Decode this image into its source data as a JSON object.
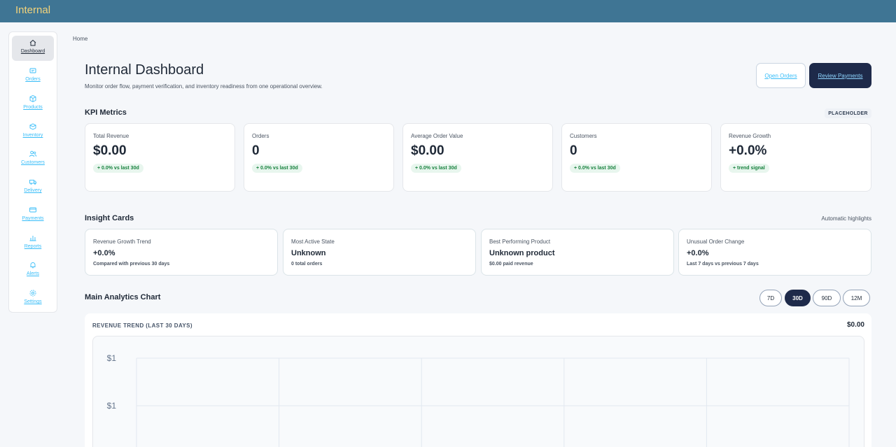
{
  "app": {
    "brand": "Internal"
  },
  "sidebar": {
    "items": [
      {
        "label": "Dashboard",
        "icon": "home-icon",
        "active": true
      },
      {
        "label": "Orders",
        "icon": "orders-icon"
      },
      {
        "label": "Products",
        "icon": "box-icon"
      },
      {
        "label": "Inventory",
        "icon": "inventory-icon"
      },
      {
        "label": "Customers",
        "icon": "users-icon"
      },
      {
        "label": "Delivery",
        "icon": "truck-icon"
      },
      {
        "label": "Payments",
        "icon": "card-icon"
      },
      {
        "label": "Reports",
        "icon": "bar-chart-icon"
      },
      {
        "label": "Alerts",
        "icon": "bell-icon"
      },
      {
        "label": "Settings",
        "icon": "gear-icon"
      }
    ]
  },
  "breadcrumb": "Home",
  "header": {
    "title": "Internal Dashboard",
    "subtitle": "Monitor order flow, payment verification, and inventory readiness from one operational overview.",
    "open_orders_label": "Open Orders",
    "review_payments_label": "Review Payments"
  },
  "kpi": {
    "section_title": "KPI Metrics",
    "tag": "PLACEHOLDER",
    "cards": [
      {
        "label": "Total Revenue",
        "value": "$0.00",
        "change": "+ 0.0% vs last 30d"
      },
      {
        "label": "Orders",
        "value": "0",
        "change": "+ 0.0% vs last 30d"
      },
      {
        "label": "Average Order Value",
        "value": "$0.00",
        "change": "+ 0.0% vs last 30d"
      },
      {
        "label": "Customers",
        "value": "0",
        "change": "+ 0.0% vs last 30d"
      },
      {
        "label": "Revenue Growth",
        "value": "+0.0%",
        "change": "+ trend signal"
      }
    ]
  },
  "insights": {
    "section_title": "Insight Cards",
    "note": "Automatic highlights",
    "cards": [
      {
        "label": "Revenue Growth Trend",
        "value": "+0.0%",
        "sub": "Compared with previous 30 days"
      },
      {
        "label": "Most Active State",
        "value": "Unknown",
        "sub": "0 total orders"
      },
      {
        "label": "Best Performing Product",
        "value": "Unknown product",
        "sub": "$0.00 paid revenue"
      },
      {
        "label": "Unusual Order Change",
        "value": "+0.0%",
        "sub": "Last 7 days vs previous 7 days"
      }
    ]
  },
  "analytics": {
    "section_title": "Main Analytics Chart",
    "ranges": [
      {
        "label": "7D",
        "active": false
      },
      {
        "label": "30D",
        "active": true
      },
      {
        "label": "90D",
        "active": false
      },
      {
        "label": "12M",
        "active": false
      }
    ],
    "chart_title": "REVENUE TREND (LAST 30 DAYS)",
    "chart_total": "$0.00"
  },
  "chart_data": {
    "type": "line",
    "title": "REVENUE TREND (LAST 30 DAYS)",
    "y_tick_labels": [
      "$1",
      "$1"
    ],
    "series": [],
    "grid": true
  },
  "colors": {
    "topbar": "#3f7594",
    "brand_text": "#f3d37a",
    "primary_button": "#1e2a4a",
    "link": "#38bdf8",
    "positive": "#16803c"
  }
}
